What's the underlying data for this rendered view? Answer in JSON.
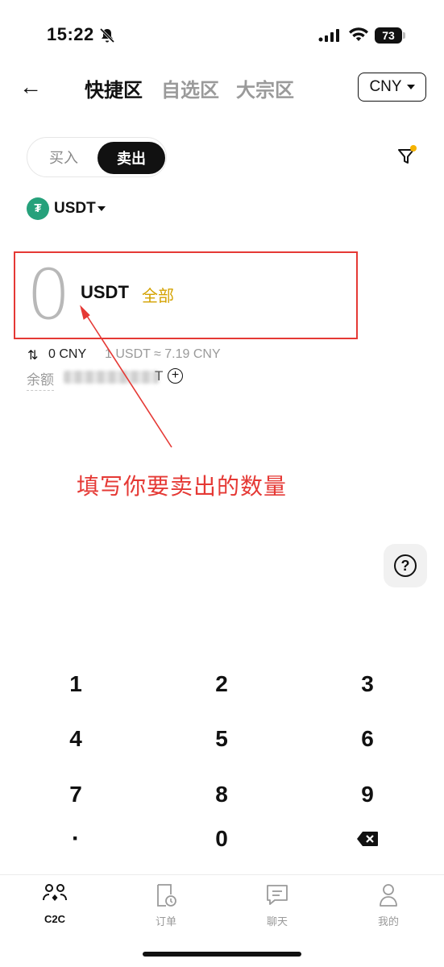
{
  "status_bar": {
    "time": "15:22",
    "battery": "73"
  },
  "header": {
    "back_label": "←",
    "tabs": [
      {
        "label": "快捷区",
        "active": true
      },
      {
        "label": "自选区",
        "active": false
      },
      {
        "label": "大宗区",
        "active": false
      }
    ],
    "currency": "CNY"
  },
  "trade_toggle": {
    "buy": "买入",
    "sell": "卖出",
    "selected": "卖出"
  },
  "coin": {
    "name": "USDT",
    "logo_glyph": "₮"
  },
  "amount": {
    "value": "0",
    "unit": "USDT",
    "all_label": "全部"
  },
  "conversion": {
    "icon": "⇅",
    "fiat_value": "0 CNY",
    "rate": "1 USDT ≈ 7.19 CNY"
  },
  "balance": {
    "label": "余额",
    "value_suffix": "T",
    "plus": "+"
  },
  "annotation": {
    "text": "填写你要卖出的数量",
    "color": "#e53935"
  },
  "help": {
    "glyph": "?"
  },
  "keypad": {
    "rows": [
      [
        "1",
        "2",
        "3"
      ],
      [
        "4",
        "5",
        "6"
      ],
      [
        "7",
        "8",
        "9"
      ],
      [
        "·",
        "0",
        "backspace-icon"
      ]
    ]
  },
  "tabbar": {
    "items": [
      {
        "label": "C2C",
        "icon": "c2c-users-icon",
        "active": true
      },
      {
        "label": "订单",
        "icon": "order-clock-icon",
        "active": false
      },
      {
        "label": "聊天",
        "icon": "chat-bubble-icon",
        "active": false
      },
      {
        "label": "我的",
        "icon": "profile-person-icon",
        "active": false
      }
    ]
  },
  "colors": {
    "accent": "#d4a200",
    "highlight": "#e53935",
    "tether": "#26a17b",
    "filter_dot": "#f5b300"
  }
}
